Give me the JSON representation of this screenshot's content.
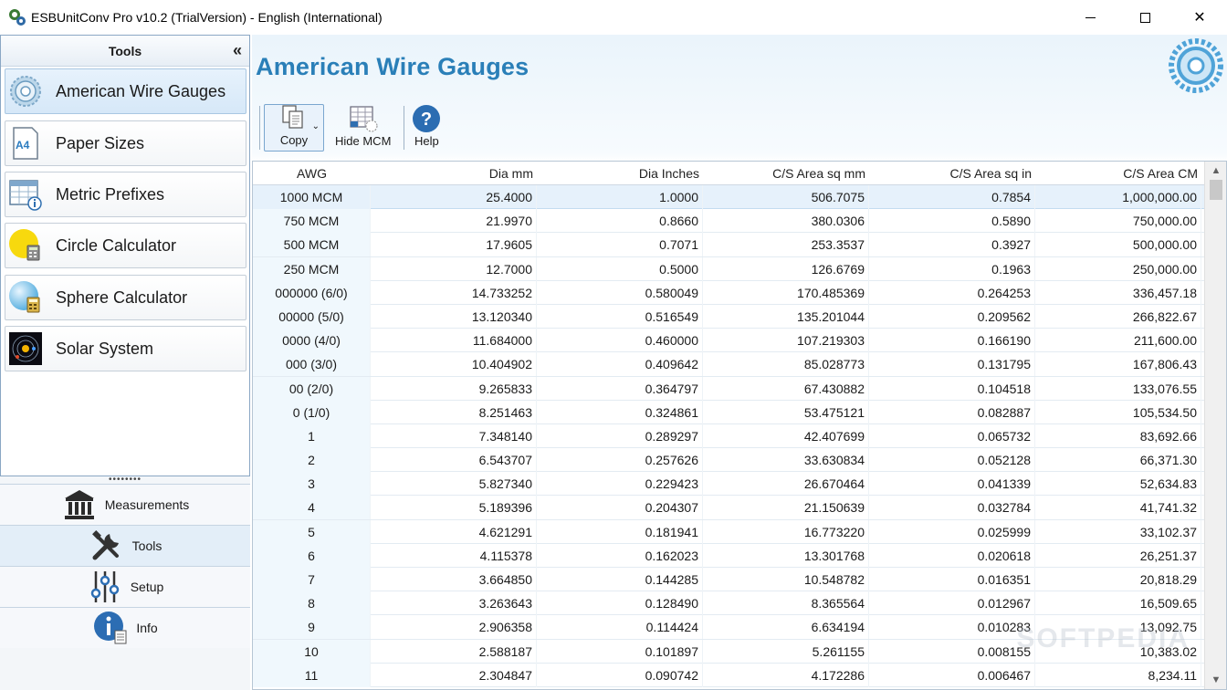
{
  "window": {
    "title": "ESBUnitConv Pro v10.2 (TrialVersion) - English (International)",
    "minimize_glyph": "",
    "close_glyph": "✕"
  },
  "sidebar": {
    "header": "Tools",
    "collapse_glyph": "«",
    "items": [
      {
        "label": "American Wire Gauges",
        "icon": "wire-gauge-icon"
      },
      {
        "label": "Paper Sizes",
        "icon": "a4-paper-icon",
        "icon_text": "A4"
      },
      {
        "label": "Metric Prefixes",
        "icon": "prefix-table-icon"
      },
      {
        "label": "Circle Calculator",
        "icon": "circle-calculator-icon"
      },
      {
        "label": "Sphere Calculator",
        "icon": "sphere-calculator-icon"
      },
      {
        "label": "Solar System",
        "icon": "solar-system-icon"
      }
    ],
    "splitter_dots": "••••••••",
    "nav": [
      {
        "label": "Measurements",
        "icon": "building-icon"
      },
      {
        "label": "Tools",
        "icon": "tools-icon"
      },
      {
        "label": "Setup",
        "icon": "sliders-icon"
      },
      {
        "label": "Info",
        "icon": "info-icon"
      }
    ]
  },
  "main": {
    "title": "American Wire Gauges",
    "toolbar": {
      "copy_label": "Copy",
      "hide_mcm_label": "Hide MCM",
      "help_label": "Help",
      "help_glyph": "?"
    },
    "table": {
      "columns": [
        "AWG",
        "Dia mm",
        "Dia Inches",
        "C/S Area sq mm",
        "C/S Area sq in",
        "C/S Area CM"
      ],
      "rows": [
        [
          "1000 MCM",
          "25.4000",
          "1.0000",
          "506.7075",
          "0.7854",
          "1,000,000.00"
        ],
        [
          "750 MCM",
          "21.9970",
          "0.8660",
          "380.0306",
          "0.5890",
          "750,000.00"
        ],
        [
          "500 MCM",
          "17.9605",
          "0.7071",
          "253.3537",
          "0.3927",
          "500,000.00"
        ],
        [
          "250 MCM",
          "12.7000",
          "0.5000",
          "126.6769",
          "0.1963",
          "250,000.00"
        ],
        [
          "000000 (6/0)",
          "14.733252",
          "0.580049",
          "170.485369",
          "0.264253",
          "336,457.18"
        ],
        [
          "00000 (5/0)",
          "13.120340",
          "0.516549",
          "135.201044",
          "0.209562",
          "266,822.67"
        ],
        [
          "0000 (4/0)",
          "11.684000",
          "0.460000",
          "107.219303",
          "0.166190",
          "211,600.00"
        ],
        [
          "000 (3/0)",
          "10.404902",
          "0.409642",
          "85.028773",
          "0.131795",
          "167,806.43"
        ],
        [
          "00 (2/0)",
          "9.265833",
          "0.364797",
          "67.430882",
          "0.104518",
          "133,076.55"
        ],
        [
          "0 (1/0)",
          "8.251463",
          "0.324861",
          "53.475121",
          "0.082887",
          "105,534.50"
        ],
        [
          "1",
          "7.348140",
          "0.289297",
          "42.407699",
          "0.065732",
          "83,692.66"
        ],
        [
          "2",
          "6.543707",
          "0.257626",
          "33.630834",
          "0.052128",
          "66,371.30"
        ],
        [
          "3",
          "5.827340",
          "0.229423",
          "26.670464",
          "0.041339",
          "52,634.83"
        ],
        [
          "4",
          "5.189396",
          "0.204307",
          "21.150639",
          "0.032784",
          "41,741.32"
        ],
        [
          "5",
          "4.621291",
          "0.181941",
          "16.773220",
          "0.025999",
          "33,102.37"
        ],
        [
          "6",
          "4.115378",
          "0.162023",
          "13.301768",
          "0.020618",
          "26,251.37"
        ],
        [
          "7",
          "3.664850",
          "0.144285",
          "10.548782",
          "0.016351",
          "20,818.29"
        ],
        [
          "8",
          "3.263643",
          "0.128490",
          "8.365564",
          "0.012967",
          "16,509.65"
        ],
        [
          "9",
          "2.906358",
          "0.114424",
          "6.634194",
          "0.010283",
          "13,092.75"
        ],
        [
          "10",
          "2.588187",
          "0.101897",
          "5.261155",
          "0.008155",
          "10,383.02"
        ],
        [
          "11",
          "2.304847",
          "0.090742",
          "4.172286",
          "0.006467",
          "8,234.11"
        ]
      ],
      "selected_row": 0
    },
    "watermark": "SOFTPEDIA"
  },
  "colors": {
    "title_blue": "#2a7fb8",
    "selection": "#e6f1fb"
  }
}
